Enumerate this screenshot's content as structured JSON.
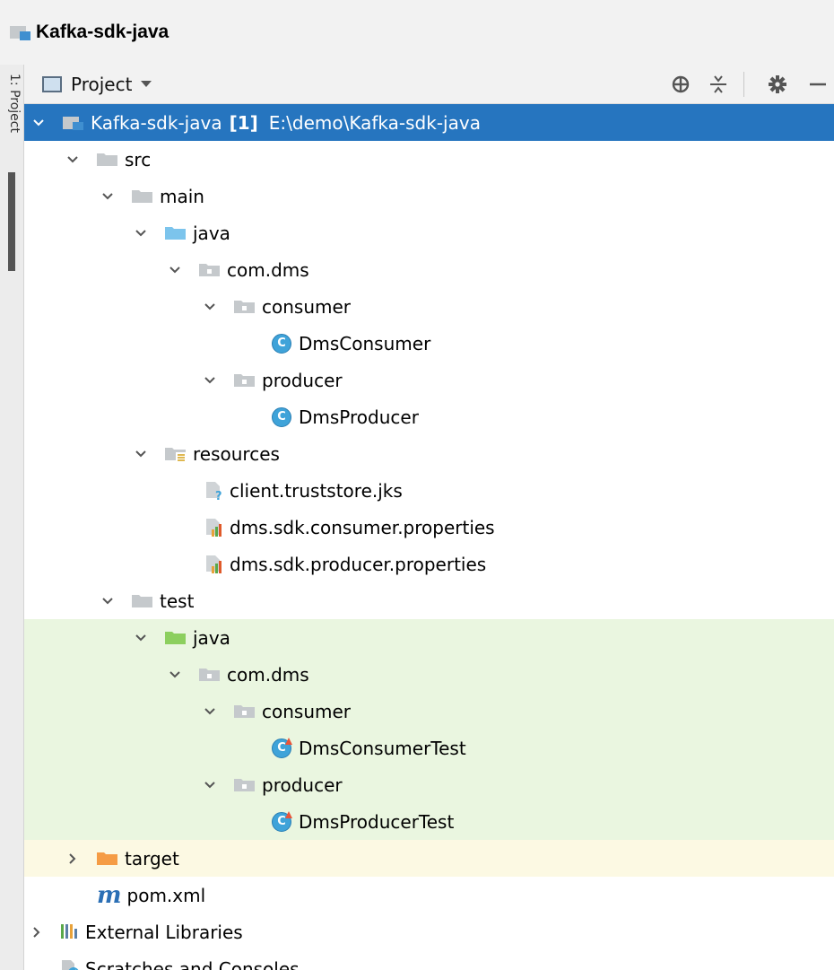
{
  "window": {
    "title": "Kafka-sdk-java"
  },
  "side_tab": {
    "label": "1: Project"
  },
  "toolbar": {
    "view_label": "Project"
  },
  "tree": {
    "root": {
      "name": "Kafka-sdk-java",
      "module_tag": "[1]",
      "path": "E:\\demo\\Kafka-sdk-java"
    },
    "src": "src",
    "main": "main",
    "main_java": "java",
    "main_pkg": "com.dms",
    "main_consumer_pkg": "consumer",
    "main_consumer_class": "DmsConsumer",
    "main_producer_pkg": "producer",
    "main_producer_class": "DmsProducer",
    "resources": "resources",
    "res_file_1": "client.truststore.jks",
    "res_file_2": "dms.sdk.consumer.properties",
    "res_file_3": "dms.sdk.producer.properties",
    "test": "test",
    "test_java": "java",
    "test_pkg": "com.dms",
    "test_consumer_pkg": "consumer",
    "test_consumer_class": "DmsConsumerTest",
    "test_producer_pkg": "producer",
    "test_producer_class": "DmsProducerTest",
    "target": "target",
    "pom": "pom.xml",
    "external_libraries": "External Libraries",
    "scratches": "Scratches and Consoles"
  },
  "colors": {
    "selection": "#2675bf",
    "test_background": "#eaf6e0",
    "excluded_background": "#fcf9e3",
    "folder_gray": "#c5c9cc",
    "folder_source": "#7cc4ec",
    "folder_test": "#8ccf5e",
    "folder_excluded": "#f59c45",
    "class_icon": "#3fa3d9"
  }
}
